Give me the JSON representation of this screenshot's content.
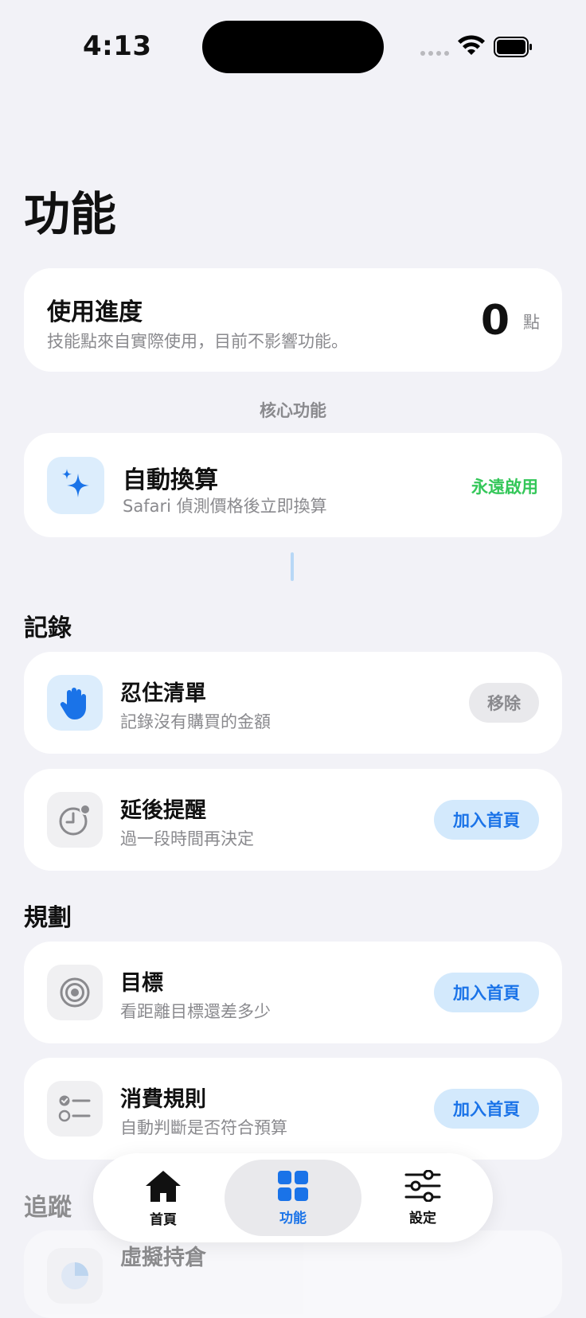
{
  "status_bar": {
    "time": "4:13"
  },
  "page": {
    "title": "功能"
  },
  "progress": {
    "title": "使用進度",
    "subtitle": "技能點來自實際使用，目前不影響功能。",
    "value": "0",
    "unit": "點"
  },
  "core": {
    "caption": "核心功能",
    "title": "自動換算",
    "subtitle": "Safari 偵測價格後立即換算",
    "status": "永遠啟用"
  },
  "sections": [
    {
      "heading": "記錄",
      "items": [
        {
          "title": "忍住清單",
          "subtitle": "記錄沒有購買的金額",
          "action": "移除",
          "icon": "hand-icon"
        },
        {
          "title": "延後提醒",
          "subtitle": "過一段時間再決定",
          "action": "加入首頁",
          "icon": "clock-badge-icon"
        }
      ]
    },
    {
      "heading": "規劃",
      "items": [
        {
          "title": "目標",
          "subtitle": "看距離目標還差多少",
          "action": "加入首頁",
          "icon": "target-icon"
        },
        {
          "title": "消費規則",
          "subtitle": "自動判斷是否符合預算",
          "action": "加入首頁",
          "icon": "checklist-icon"
        }
      ]
    },
    {
      "heading": "追蹤",
      "items": [
        {
          "title": "虛擬持倉",
          "icon": "pie-chart-icon"
        }
      ]
    }
  ],
  "tabbar": {
    "tabs": [
      {
        "label": "首頁",
        "icon": "house-icon"
      },
      {
        "label": "功能",
        "icon": "grid-icon",
        "active": true
      },
      {
        "label": "設定",
        "icon": "sliders-icon"
      }
    ]
  },
  "colors": {
    "background": "#f2f2f7",
    "accent": "#1a73e8",
    "enabled": "#34c759"
  }
}
